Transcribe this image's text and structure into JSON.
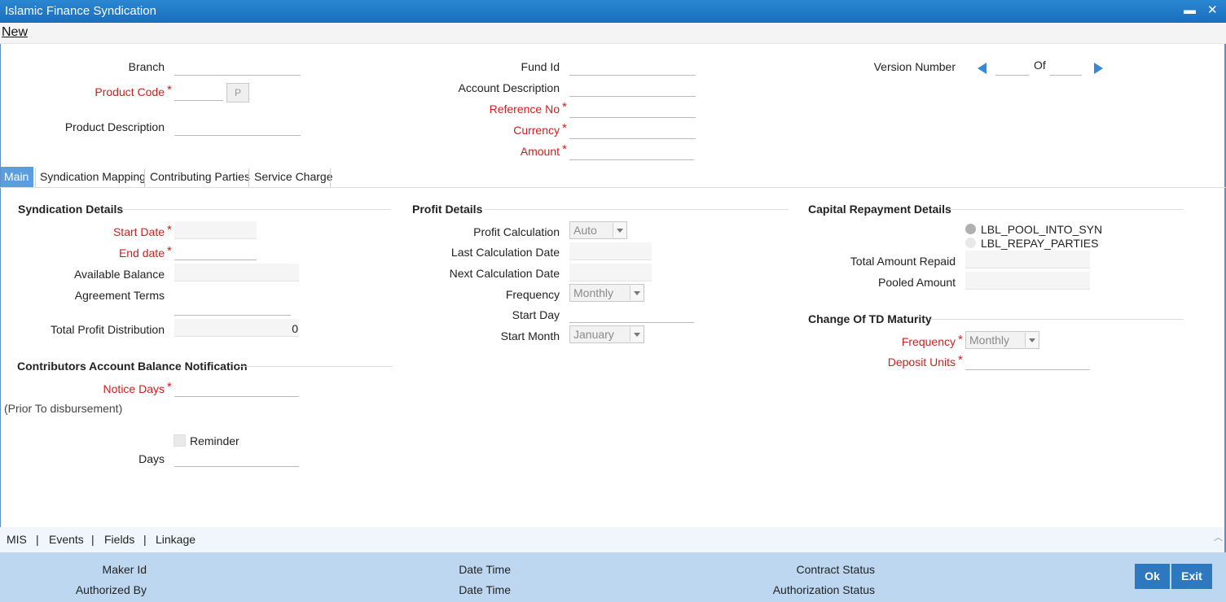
{
  "window": {
    "title": "Islamic Finance Syndication",
    "minimize": "▬",
    "close": "✕"
  },
  "toolbar": {
    "new_label": "New"
  },
  "header": {
    "branch": "Branch",
    "product_code": "Product Code",
    "product_code_btn": "P",
    "product_description": "Product Description",
    "fund_id": "Fund Id",
    "account_description": "Account Description",
    "reference_no": "Reference No",
    "currency": "Currency",
    "amount": "Amount",
    "version_number": "Version Number",
    "of": "Of",
    "required_marker": "*"
  },
  "tabs": [
    {
      "label": "Main",
      "active": true
    },
    {
      "label": "Syndication Mapping",
      "active": false
    },
    {
      "label": "Contributing Parties",
      "active": false
    },
    {
      "label": "Service Charge",
      "active": false
    }
  ],
  "syndication": {
    "title": "Syndication Details",
    "start_date": "Start Date",
    "end_date": "End date",
    "available_balance": "Available Balance",
    "agreement_terms": "Agreement Terms",
    "total_profit_distribution": "Total Profit Distribution",
    "total_profit_value": "0"
  },
  "contributors": {
    "title": "Contributors Account Balance Notification",
    "notice_days": "Notice Days",
    "prior_note": "(Prior To disbursement)",
    "reminder": "Reminder",
    "days": "Days"
  },
  "profit": {
    "title": "Profit Details",
    "profit_calculation": "Profit Calculation",
    "profit_calculation_value": "Auto",
    "last_calc_date": "Last Calculation Date",
    "next_calc_date": "Next Calculation Date",
    "frequency": "Frequency",
    "frequency_value": "Monthly",
    "start_day": "Start Day",
    "start_month": "Start Month",
    "start_month_value": "January"
  },
  "capital": {
    "title": "Capital Repayment Details",
    "radio_pool": "LBL_POOL_INTO_SYN",
    "radio_repay": "LBL_REPAY_PARTIES",
    "total_amount_repaid": "Total Amount Repaid",
    "pooled_amount": "Pooled Amount"
  },
  "td_maturity": {
    "title": "Change Of TD Maturity",
    "frequency": "Frequency",
    "frequency_value": "Monthly",
    "deposit_units": "Deposit Units"
  },
  "bottom_links": {
    "mis": "MIS",
    "events": "Events",
    "fields": "Fields",
    "linkage": "Linkage",
    "sep": "|"
  },
  "footer": {
    "maker_id": "Maker Id",
    "authorized_by": "Authorized By",
    "date_time_1": "Date Time",
    "date_time_2": "Date Time",
    "contract_status": "Contract Status",
    "authorization_status": "Authorization Status",
    "ok": "Ok",
    "exit": "Exit"
  },
  "colors": {
    "title_bar": "#1a6fbe",
    "required": "#cc1f1f",
    "tab_active": "#5a9ee0",
    "footer": "#bcd7ef",
    "button": "#2d78bf"
  }
}
